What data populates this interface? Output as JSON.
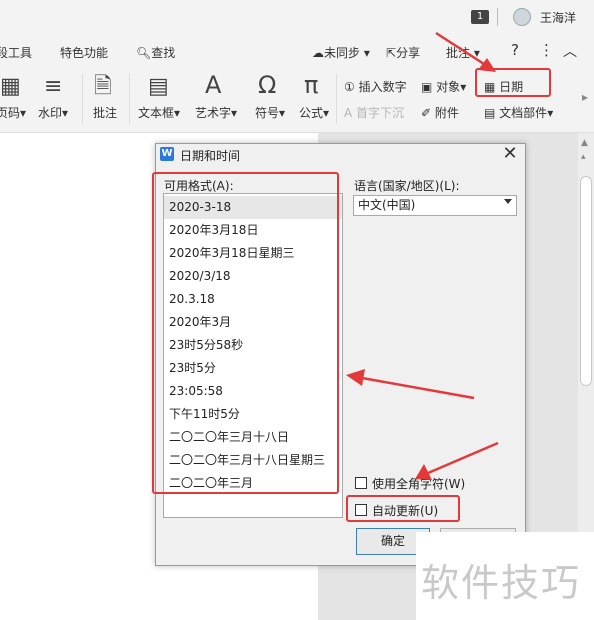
{
  "topbar": {
    "badge": "1",
    "username": "王海洋"
  },
  "tabs": {
    "partial_tool": "段工具",
    "special": "特色功能",
    "search": "查找",
    "sync": "未同步",
    "share": "分享",
    "comment": "批注",
    "help": "?",
    "more": "⋮",
    "collapse": "︿"
  },
  "ribbon": {
    "page_num": "页码",
    "watermark": "水印",
    "comment": "批注",
    "textbox": "文本框",
    "wordart": "艺术字",
    "symbol": "符号",
    "formula": "公式",
    "insert_number": "插入数字",
    "object": "对象",
    "date": "日期",
    "drop_cap": "首字下沉",
    "attachment": "附件",
    "doc_parts": "文档部件"
  },
  "dialog": {
    "icon_letter": "W",
    "title": "日期和时间",
    "formats_label": "可用格式(A):",
    "formats": [
      "2020-3-18",
      "2020年3月18日",
      "2020年3月18日星期三",
      "2020/3/18",
      "20.3.18",
      "2020年3月",
      "23时5分58秒",
      "23时5分",
      "23:05:58",
      "下午11时5分",
      "二〇二〇年三月十八日",
      "二〇二〇年三月十八日星期三",
      "二〇二〇年三月"
    ],
    "selected_format": "2020-3-18",
    "language_label": "语言(国家/地区)(L):",
    "language_value": "中文(中国)",
    "fullwidth_label": "使用全角字符(W)",
    "autoupdate_label": "自动更新(U)",
    "ok_label": "确定"
  },
  "watermark_text": "软件技巧",
  "colors": {
    "annotation_red": "#e23a3a",
    "accent_blue": "#2b79d9"
  }
}
